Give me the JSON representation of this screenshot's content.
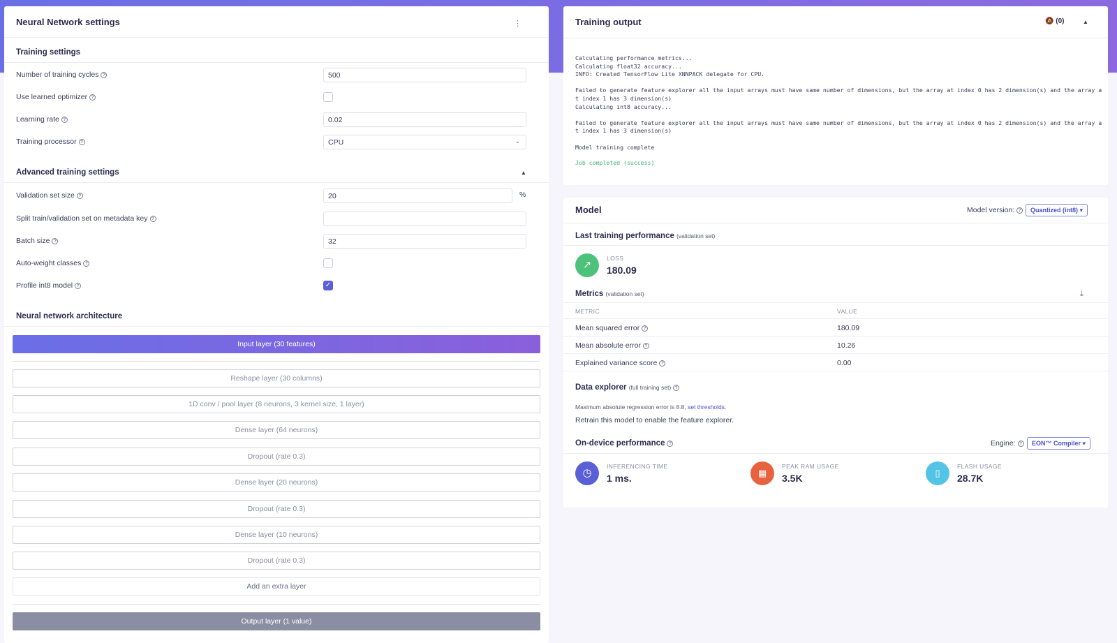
{
  "nn": {
    "title": "Neural Network settings",
    "training_header": "Training settings",
    "cycles_label": "Number of training cycles",
    "cycles_value": "500",
    "learned_opt_label": "Use learned optimizer",
    "lr_label": "Learning rate",
    "lr_value": "0.02",
    "processor_label": "Training processor",
    "processor_value": "CPU",
    "advanced_header": "Advanced training settings",
    "val_label": "Validation set size",
    "val_value": "20",
    "val_unit": "%",
    "split_label": "Split train/validation set on metadata key",
    "split_value": "",
    "batch_label": "Batch size",
    "batch_value": "32",
    "autoweight_label": "Auto-weight classes",
    "profile_label": "Profile int8 model",
    "arch_header": "Neural network architecture",
    "input_layer": "Input layer (30 features)",
    "layers": [
      "Reshape layer (30 columns)",
      "1D conv / pool layer (8 neurons, 3 kernel size, 1 layer)",
      "Dense layer (64 neurons)",
      "Dropout (rate 0.3)",
      "Dense layer (20 neurons)",
      "Dropout (rate 0.3)",
      "Dense layer (10 neurons)",
      "Dropout (rate 0.3)",
      "Add an extra layer"
    ],
    "output_layer": "Output layer (1 value)"
  },
  "output": {
    "title": "Training output",
    "notif_count": "(0)",
    "log": "Calculating performance metrics...\nCalculating float32 accuracy...\nINFO: Created TensorFlow Lite XNNPACK delegate for CPU.\n\nFailed to generate feature explorer all the input arrays must have same number of dimensions, but the array at index 0 has 2 dimension(s) and the array a\nt index 1 has 3 dimension(s)\nCalculating int8 accuracy...\n\nFailed to generate feature explorer all the input arrays must have same number of dimensions, but the array at index 0 has 2 dimension(s) and the array a\nt index 1 has 3 dimension(s)\n\nModel training complete",
    "success": "Job completed (success)"
  },
  "model": {
    "title": "Model",
    "version_label": "Model version:",
    "version_value": "Quantized (int8)",
    "last_perf": "Last training performance",
    "last_perf_note": "(validation set)",
    "loss_label": "LOSS",
    "loss_value": "180.09",
    "metrics_title": "Metrics",
    "metrics_note": "(validation set)",
    "col_metric": "METRIC",
    "col_value": "VALUE",
    "rows": [
      {
        "name": "Mean squared error",
        "value": "180.09"
      },
      {
        "name": "Mean absolute error",
        "value": "10.26"
      },
      {
        "name": "Explained variance score",
        "value": "0.00"
      }
    ],
    "explorer_title": "Data explorer",
    "explorer_note": "(full training set)",
    "explorer_text": "Maximum absolute regression error is 8.8,",
    "explorer_link": "set thresholds.",
    "retrain_text": "Retrain this model to enable the feature explorer.",
    "device_title": "On-device performance",
    "engine_label": "Engine:",
    "engine_value": "EON™ Compiler",
    "inf_label": "INFERENCING TIME",
    "inf_value": "1 ms.",
    "ram_label": "PEAK RAM USAGE",
    "ram_value": "3.5K",
    "flash_label": "FLASH USAGE",
    "flash_value": "28.7K"
  },
  "colors": {
    "accent": "#5a5fd6",
    "success": "#3cb371",
    "loss": "#4cc27a",
    "ram": "#e8623f",
    "flash": "#54c4e6",
    "output_layer": "#8b8ea3"
  }
}
